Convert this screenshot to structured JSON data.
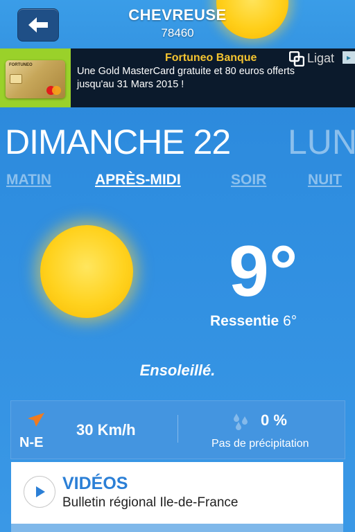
{
  "header": {
    "city": "CHEVREUSE",
    "zip": "78460"
  },
  "ad": {
    "title": "Fortuneo Banque",
    "text": "Une Gold MasterCard gratuite et 80 euros offerts jusqu'au 31 Mars 2015 !",
    "network": "Ligat",
    "card_brand": "FORTUNEO"
  },
  "day": {
    "current": "DIMANCHE 22",
    "next": "LUN"
  },
  "periods": [
    {
      "label": "MATIN",
      "active": false
    },
    {
      "label": "APRÈS-MIDI",
      "active": true
    },
    {
      "label": "SOIR",
      "active": false
    },
    {
      "label": "NUIT",
      "active": false
    }
  ],
  "weather": {
    "temperature": "9°",
    "feels_label": "Ressentie",
    "feels_value": "6°",
    "condition": "Ensoleillé."
  },
  "wind": {
    "direction": "N-E",
    "speed": "30 Km/h"
  },
  "precipitation": {
    "percent": "0 %",
    "label": "Pas de précipitation"
  },
  "videos": {
    "title": "VIDÉOS",
    "subtitle": "Bulletin régional Ile-de-France"
  },
  "colors": {
    "background": "#2f8ee0",
    "ad_title": "#f4c430",
    "videos_title": "#2b7fd6",
    "wind_arrow": "#f07b1f"
  },
  "icons": {
    "back": "arrow-left-icon",
    "sun": "sun-icon",
    "wind": "wind-direction-arrow-icon",
    "rain": "raindrops-icon",
    "play": "play-icon"
  }
}
